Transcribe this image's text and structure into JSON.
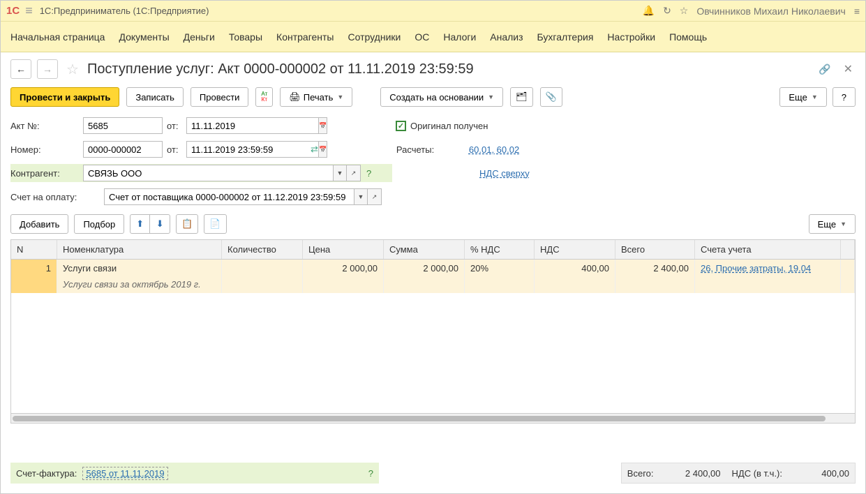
{
  "app": {
    "title": "1С:Предприниматель  (1С:Предприятие)",
    "logo": "1С",
    "user": "Овчинников Михаил Николаевич"
  },
  "menu": {
    "home": "Начальная страница",
    "docs": "Документы",
    "money": "Деньги",
    "goods": "Товары",
    "contr": "Контрагенты",
    "emp": "Сотрудники",
    "os": "ОС",
    "tax": "Налоги",
    "analysis": "Анализ",
    "acc": "Бухгалтерия",
    "settings": "Настройки",
    "help": "Помощь"
  },
  "doc": {
    "title": "Поступление услуг: Акт 0000-000002 от 11.11.2019 23:59:59"
  },
  "toolbar": {
    "post_close": "Провести и закрыть",
    "write": "Записать",
    "post": "Провести",
    "print": "Печать",
    "create_based": "Создать на основании",
    "more": "Еще",
    "help": "?"
  },
  "form": {
    "act_no_lbl": "Акт №:",
    "act_no": "5685",
    "from_lbl": "от:",
    "act_date": "11.11.2019",
    "num_lbl": "Номер:",
    "num": "0000-000002",
    "num_date": "11.11.2019 23:59:59",
    "orig_lbl": "Оригинал получен",
    "calc_lbl": "Расчеты:",
    "calc_val": "60.01, 60.02",
    "vat_mode": "НДС сверху",
    "contr_lbl": "Контрагент:",
    "contr": "СВЯЗЬ ООО",
    "contr_help": "?",
    "inv_lbl": "Счет на оплату:",
    "inv": "Счет от поставщика 0000-000002 от 11.12.2019 23:59:59"
  },
  "tbl_toolbar": {
    "add": "Добавить",
    "pick": "Подбор",
    "more": "Еще"
  },
  "tbl": {
    "head": {
      "n": "N",
      "nom": "Номенклатура",
      "qty": "Количество",
      "price": "Цена",
      "sum": "Сумма",
      "vat": "% НДС",
      "vats": "НДС",
      "tot": "Всего",
      "acc": "Счета учета"
    },
    "rows": [
      {
        "n": "1",
        "nom": "Услуги связи",
        "desc": "Услуги связи за октябрь 2019 г.",
        "qty": "",
        "price": "2 000,00",
        "sum": "2 000,00",
        "vat": "20%",
        "vats": "400,00",
        "tot": "2 400,00",
        "acc": "26, Прочие затраты, 19.04"
      }
    ]
  },
  "footer": {
    "sf_lbl": "Счет-фактура:",
    "sf_val": "5685 от 11.11.2019",
    "sf_help": "?",
    "tot_lbl": "Всего:",
    "tot_val": "2 400,00",
    "vat_lbl": "НДС (в т.ч.):",
    "vat_val": "400,00"
  }
}
